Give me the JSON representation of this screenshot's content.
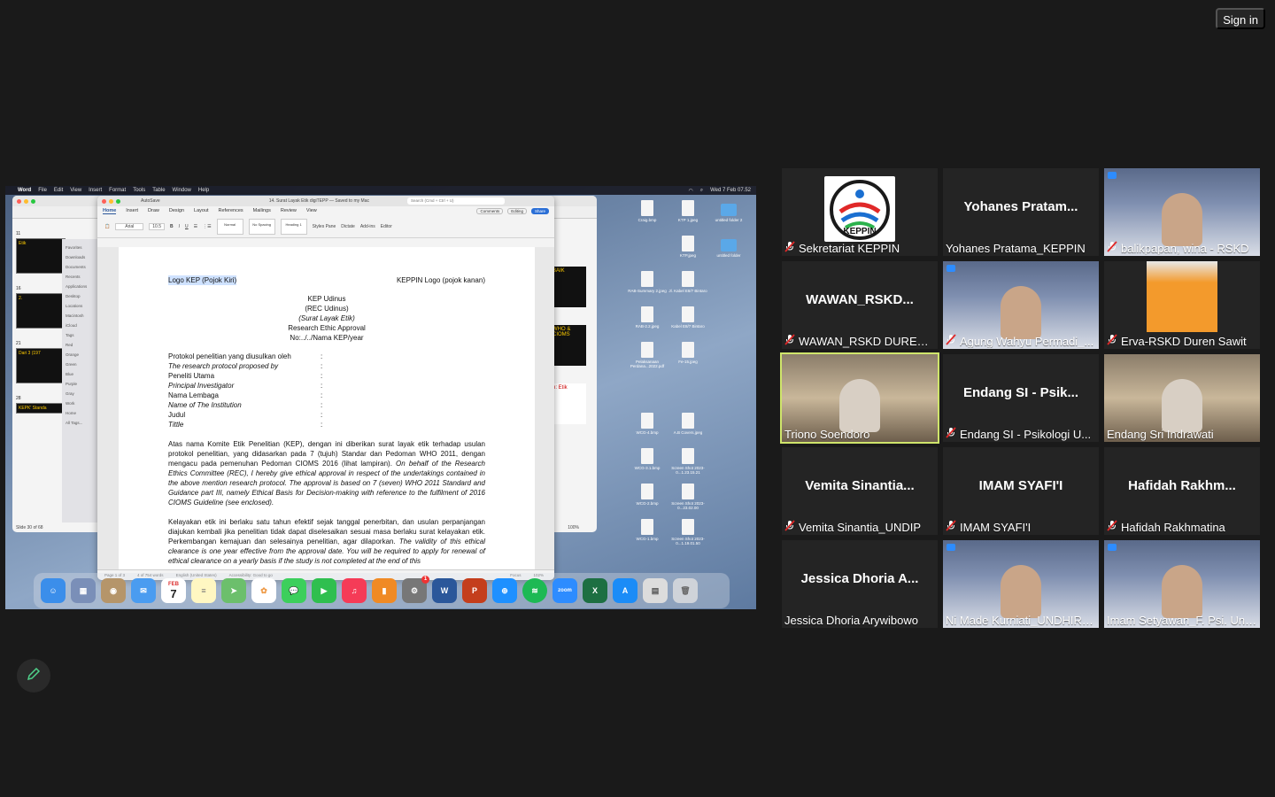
{
  "signin_label": "Sign in",
  "shared_screen": {
    "menubar": {
      "app": "Word",
      "menus": [
        "File",
        "Edit",
        "View",
        "Insert",
        "Format",
        "Tools",
        "Table",
        "Window",
        "Help"
      ],
      "clock": "Wed 7 Feb 07.52"
    },
    "ppt": {
      "status": "Slide 30 of 68",
      "zoom": "100%",
      "slide_numbers": [
        "11",
        "16",
        "21",
        "28"
      ],
      "slide_titles": [
        "Etik",
        "2.",
        "Dari 3 (197",
        "KEPK' Standa"
      ],
      "right_titles": [
        "BAIK",
        "WHO & CIOMS",
        "n: Etik"
      ]
    },
    "finder_sidebar": [
      "Favorites",
      "Downloads",
      "Documents",
      "Recents",
      "Applications",
      "Desktop",
      "Locations",
      "Macintosh",
      "iCloud",
      "Tags",
      "Red",
      "Orange",
      "Green",
      "Blue",
      "Purple",
      "Gray",
      "Work",
      "Home",
      "All Tags..."
    ],
    "word": {
      "title": "14. Surat Layak Etik digiTEPP — Saved to my Mac",
      "search_placeholder": "Search (Cmd + Ctrl + U)",
      "autosave": "AutoSave",
      "tabs": [
        "Home",
        "Insert",
        "Draw",
        "Design",
        "Layout",
        "References",
        "Mailings",
        "Review",
        "View"
      ],
      "buttons": {
        "comments": "Comments",
        "editing": "Editing",
        "share": "Share"
      },
      "font": "Arial",
      "font_size": "10.5",
      "styles": [
        "Normal",
        "No Spacing",
        "Heading 1"
      ],
      "ribbon_tools": [
        "Styles Pane",
        "Dictate",
        "Add-ins",
        "Editor"
      ],
      "status": {
        "page": "Page 1 of 3",
        "words": "4 of 754 words",
        "language": "English (United States)",
        "accessibility": "Accessibility: Good to go",
        "focus": "Focus",
        "zoom": "102%"
      },
      "doc": {
        "logo_left": "Logo KEP (Pojok Kiri)",
        "logo_right": "KEPPIN Logo (pojok kanan)",
        "head1": "KEP Udinus",
        "head2": "(REC Udinus)",
        "head3": "(Surat Layak Etik)",
        "head4": "Research Ethic Approval",
        "head5": "No:../../Nama KEP/year",
        "fields": [
          {
            "k": "Protokol penelitian yang diusulkan oleh",
            "v": ":"
          },
          {
            "k": "The research protocol proposed by",
            "v": ":"
          },
          {
            "k": "Peneliti Utama",
            "v": ":"
          },
          {
            "k": "Principal Investigator",
            "v": ":"
          },
          {
            "k": "Nama Lembaga",
            "v": ":"
          },
          {
            "k": "Name of The Institution",
            "v": ":"
          },
          {
            "k": "Judul",
            "v": ":"
          },
          {
            "k": "Tittle",
            "v": ":"
          }
        ],
        "para1_id": "Atas nama Komite Etik Penelitian (KEP), dengan ini diberikan surat layak etik terhadap usulan protokol penelitian, yang didasarkan pada 7 (tujuh) Standar dan Pedoman WHO 2011, dengan mengacu pada pemenuhan Pedoman CIOMS 2016 (lihat lampiran).",
        "para1_en": "On behalf of the Research Ethics Committee (REC), I hereby give ethical approval in respect of the undertakings contained in the above mention research protocol. The approval is based on 7 (seven) WHO 2011 Standard and Guidance part III, namely Ethical Basis for Decision-making with reference to the fulfilment of 2016 CIOMS Guideline (see enclosed).",
        "para2_id": "Kelayakan etik ini berlaku satu tahun efektif sejak tanggal penerbitan, dan usulan perpanjangan diajukan kembali jika penelitian tidak dapat diselesaikan sesuai masa berlaku surat kelayakan etik. Perkembangan kemajuan dan selesainya penelitian, agar dilaporkan.",
        "para2_en": "The validity of this ethical clearance is one year effective from the approval date. You will be required to apply for renewal of ethical clearance on a yearly basis if the study is not completed at the end of this"
      }
    },
    "desktop_files": [
      "Craig.bmp",
      "KTP 1.jpeg",
      "untitled folder 2",
      "",
      "KTP.jpeg",
      "untitled folder",
      "RAB-Summary 2.jpeg",
      "Jl. Kabel E8/7 Bintaro",
      "",
      "RAB-2.2.jpeg",
      "Kabel E8/7 Bintaro",
      "",
      "Pelaksanaan Perdana...2022.pdf",
      "Fe-15.jpeg",
      "",
      "",
      "",
      "",
      "WCG-4.bmp",
      "A.B Covers.jpeg",
      "",
      "WCG-3.1.bmp",
      "Screen Shot 2023-0...1.23.15.21",
      "",
      "WCG-2.bmp",
      "Screen Shot 2023-0...23.02.00",
      "",
      "WCG-1.bmp",
      "Screen Shot 2023-0...1.19.01.50",
      ""
    ],
    "dock_apps": [
      "Finder",
      "Launchpad",
      "Contacts",
      "Mail",
      "Calendar",
      "Notes",
      "Maps",
      "Photos",
      "Messages",
      "FaceTime",
      "Music",
      "Books",
      "Settings",
      "Word",
      "PowerPoint",
      "Safari",
      "Spotify",
      "Zoom",
      "Excel",
      "App Store",
      "Preview",
      "Trash"
    ],
    "dock_calendar": {
      "month": "FEB",
      "day": "7"
    },
    "dock_badge": "1"
  },
  "participants": [
    {
      "name": "Sekretariat KEPPIN",
      "big": "",
      "muted": true,
      "kind": "logo",
      "logo_text": "KEPPIN"
    },
    {
      "name": "Yohanes Pratama_KEPPIN",
      "big": "Yohanes  Pratam...",
      "muted": false,
      "kind": "name"
    },
    {
      "name": "balikpapan, wina - RSKD",
      "big": "",
      "muted": true,
      "kind": "video-banner"
    },
    {
      "name": "WAWAN_RSKD DUREN S...",
      "big": "WAWAN_RSKD...",
      "muted": true,
      "kind": "name"
    },
    {
      "name": "Agung Wahyu Permadi_...",
      "big": "",
      "muted": true,
      "kind": "video-banner"
    },
    {
      "name": "Erva-RSKD Duren Sawit",
      "big": "",
      "muted": true,
      "kind": "photo"
    },
    {
      "name": "Triono Soendoro",
      "big": "",
      "muted": false,
      "kind": "video-room",
      "speaking": true
    },
    {
      "name": "Endang SI - Psikologi U...",
      "big": "Endang SI  -  Psik...",
      "muted": true,
      "kind": "name"
    },
    {
      "name": "Endang Sri Indrawati",
      "big": "",
      "muted": false,
      "kind": "video-room"
    },
    {
      "name": "Vemita Sinantia_UNDIP",
      "big": "Vemita  Sinantia...",
      "muted": true,
      "kind": "name"
    },
    {
      "name": "IMAM SYAFI'I",
      "big": "IMAM  SYAFI'I",
      "muted": true,
      "kind": "name"
    },
    {
      "name": "Hafidah Rakhmatina",
      "big": "Hafidah  Rakhm...",
      "muted": true,
      "kind": "name"
    },
    {
      "name": "Jessica Dhoria Arywibowo",
      "big": "Jessica Dhoria A...",
      "muted": false,
      "kind": "name"
    },
    {
      "name": "Ni Made Kurniati_UNDHIRA...",
      "big": "",
      "muted": false,
      "kind": "video-banner"
    },
    {
      "name": "Imam Setyawan_F. Psi. Undip",
      "big": "",
      "muted": false,
      "kind": "video-banner"
    }
  ],
  "colors": {
    "background": "#1a1a1a",
    "tile": "#242424",
    "speaker_outline": "#cfe56b",
    "mute_red": "#e02828"
  }
}
